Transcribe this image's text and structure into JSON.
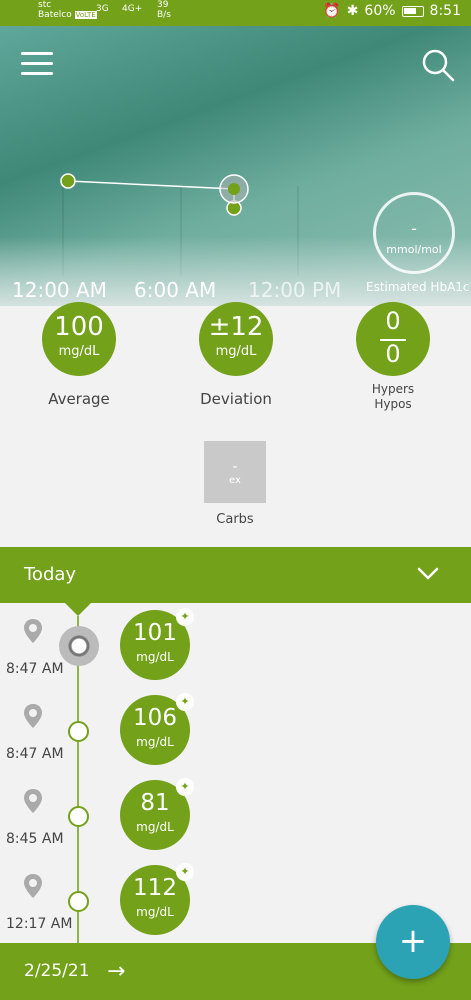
{
  "status_bar": {
    "carrier1": "stc",
    "carrier2": "Batelco",
    "volte": "VoLTE",
    "net1": "3G",
    "net2": "4G+",
    "speed": "39",
    "speed_unit": "B/s",
    "battery": "60%",
    "time": "8:51"
  },
  "chart": {
    "x_labels": [
      "12:00 AM",
      "6:00 AM",
      "12:00 PM"
    ]
  },
  "hba1c": {
    "value": "-",
    "unit": "mmol/mol",
    "label": "Estimated HbA1c"
  },
  "stats": {
    "average": {
      "value": "100",
      "unit": "mg/dL",
      "label": "Average"
    },
    "deviation": {
      "value": "±12",
      "unit": "mg/dL",
      "label": "Deviation"
    },
    "hypers_hypos": {
      "hypers": "0",
      "hypos": "0",
      "label1": "Hypers",
      "label2": "Hypos"
    },
    "carbs": {
      "value": "-",
      "unit": "ex",
      "label": "Carbs"
    }
  },
  "today": {
    "label": "Today"
  },
  "entries": [
    {
      "time": "8:47 AM",
      "value": "101",
      "unit": "mg/dL"
    },
    {
      "time": "8:47 AM",
      "value": "106",
      "unit": "mg/dL"
    },
    {
      "time": "8:45 AM",
      "value": "81",
      "unit": "mg/dL"
    },
    {
      "time": "12:17 AM",
      "value": "112",
      "unit": "mg/dL"
    }
  ],
  "bottom": {
    "date": "2/25/21",
    "arrow": "→"
  },
  "fab": {
    "label": "+"
  },
  "colors": {
    "accent": "#73a11a",
    "fab": "#2ba3b5"
  }
}
